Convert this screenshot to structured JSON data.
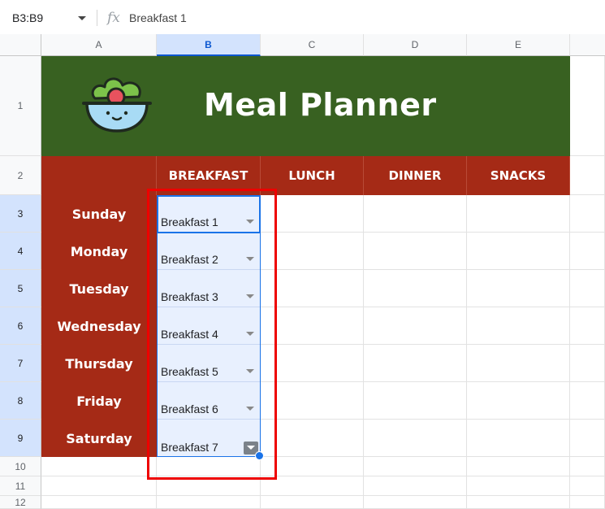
{
  "formula_bar": {
    "name_box": "B3:B9",
    "fx_label": "fx",
    "value": "Breakfast 1"
  },
  "columns": [
    "A",
    "B",
    "C",
    "D",
    "E"
  ],
  "rows": [
    "1",
    "2",
    "3",
    "4",
    "5",
    "6",
    "7",
    "8",
    "9",
    "10",
    "11",
    "12"
  ],
  "banner": {
    "title": "Meal Planner",
    "icon": "salad-bowl-icon"
  },
  "headers": [
    "BREAKFAST",
    "LUNCH",
    "DINNER",
    "SNACKS"
  ],
  "days": [
    "Sunday",
    "Monday",
    "Tuesday",
    "Wednesday",
    "Thursday",
    "Friday",
    "Saturday"
  ],
  "breakfast": [
    "Breakfast 1",
    "Breakfast 2",
    "Breakfast 3",
    "Breakfast 4",
    "Breakfast 5",
    "Breakfast 6",
    "Breakfast 7"
  ],
  "colors": {
    "banner": "#386121",
    "header": "#a52a16",
    "selection": "#1a73e8",
    "highlight": "#ee0000"
  }
}
